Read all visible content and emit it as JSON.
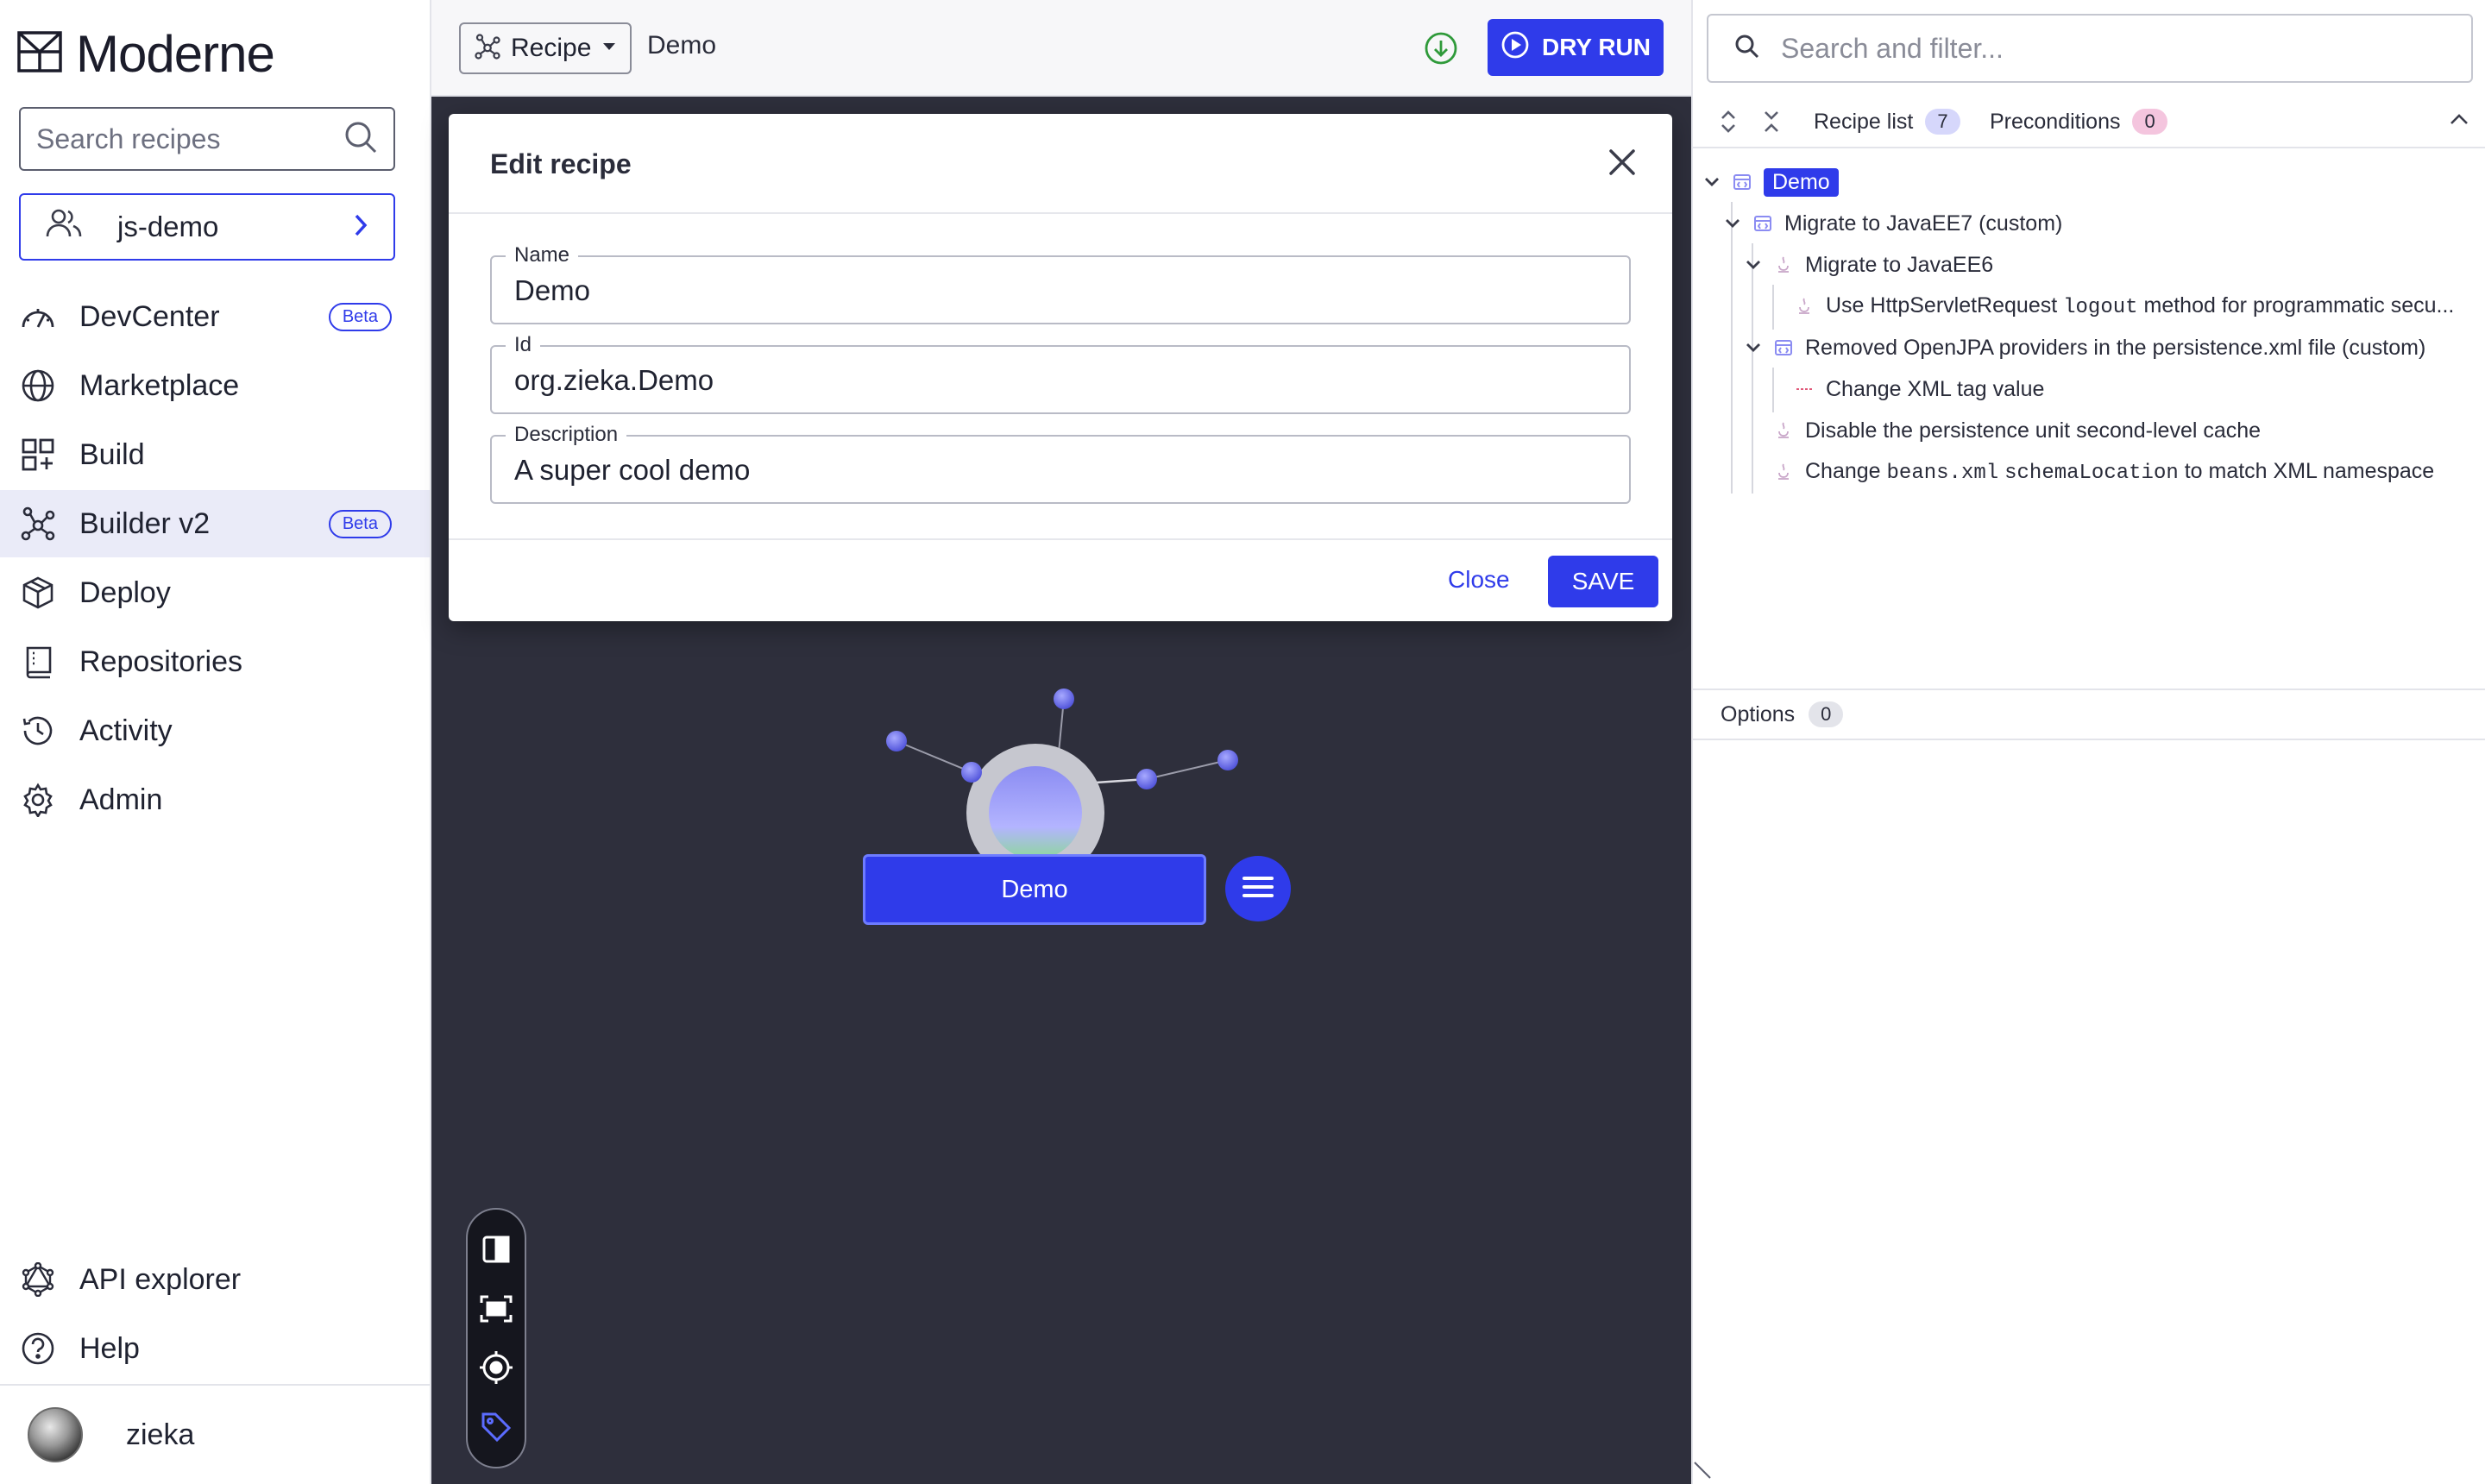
{
  "sidebar": {
    "logo_text": "Moderne",
    "search_placeholder": "Search recipes",
    "org_name": "js-demo",
    "nav": [
      {
        "label": "DevCenter",
        "badge": "Beta"
      },
      {
        "label": "Marketplace"
      },
      {
        "label": "Build"
      },
      {
        "label": "Builder v2",
        "badge": "Beta",
        "active": true
      },
      {
        "label": "Deploy"
      },
      {
        "label": "Repositories"
      },
      {
        "label": "Activity"
      },
      {
        "label": "Admin"
      }
    ],
    "bottom_nav": [
      {
        "label": "API explorer"
      },
      {
        "label": "Help"
      }
    ],
    "user_name": "zieka"
  },
  "topbar": {
    "select_label": "Recipe",
    "breadcrumb": "Demo",
    "dry_run_label": "DRY RUN"
  },
  "canvas": {
    "node_label": "Demo"
  },
  "modal": {
    "title": "Edit recipe",
    "fields": [
      {
        "label": "Name",
        "value": "Demo"
      },
      {
        "label": "Id",
        "value": "org.zieka.Demo"
      },
      {
        "label": "Description",
        "value": "A super cool demo"
      }
    ],
    "close_label": "Close",
    "save_label": "SAVE"
  },
  "right_panel": {
    "search_placeholder": "Search and filter...",
    "tabs": [
      {
        "label": "Recipe list",
        "count": "7"
      },
      {
        "label": "Preconditions",
        "count": "0"
      }
    ],
    "tree": [
      {
        "label": "Demo"
      },
      {
        "label": "Migrate to JavaEE7 (custom)"
      },
      {
        "label": "Migrate to JavaEE6"
      },
      {
        "pre": "Use HttpServletRequest ",
        "code": "logout",
        "post": " method for programmatic secu..."
      },
      {
        "label": "Removed OpenJPA providers in the persistence.xml file (custom)"
      },
      {
        "label": "Change XML tag value"
      },
      {
        "label": "Disable the persistence unit second-level cache"
      },
      {
        "pre": "Change ",
        "code": "beans.xml",
        "mid": " ",
        "code2": "schemaLocation",
        "post": " to match XML namespace"
      }
    ],
    "options_label": "Options",
    "options_count": "0"
  },
  "colors": {
    "accent": "#2f3bea",
    "canvas_bg": "#2e2f3c",
    "active_nav_bg": "#eaebf8"
  }
}
